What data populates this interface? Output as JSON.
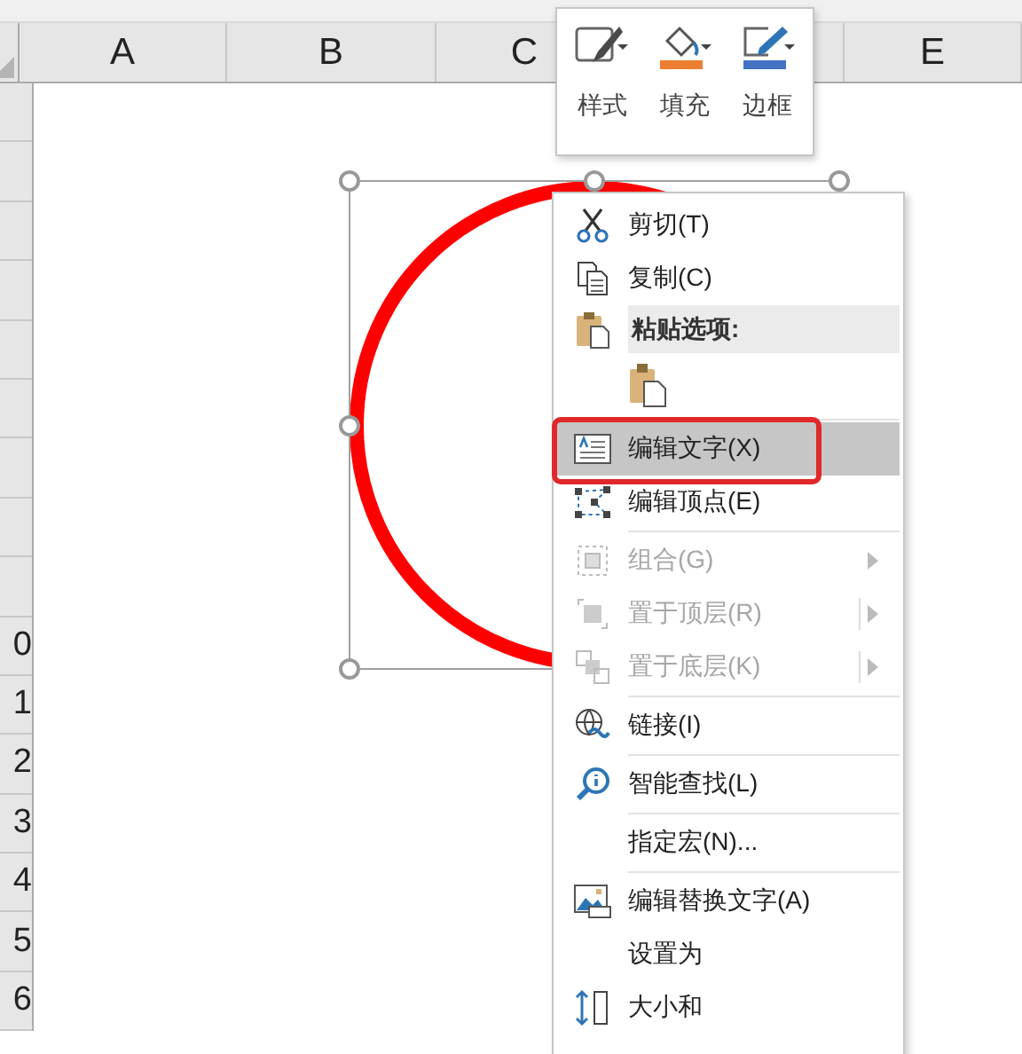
{
  "column_headers": [
    "A",
    "B",
    "C",
    "E"
  ],
  "row_headers": [
    "0",
    "1",
    "2",
    "3",
    "4",
    "5",
    "6"
  ],
  "mini_toolbar": [
    {
      "label": "样式",
      "kind": "style"
    },
    {
      "label": "填充",
      "kind": "fill",
      "color": "#ed7d31"
    },
    {
      "label": "边框",
      "kind": "outline",
      "color": "#4472c4"
    }
  ],
  "context_menu": [
    {
      "kind": "item",
      "label": "剪切(T)",
      "disabled": false,
      "selected": false
    },
    {
      "kind": "item",
      "label": "复制(C)",
      "disabled": false,
      "selected": false
    },
    {
      "kind": "header",
      "label": "粘贴选项:"
    },
    {
      "kind": "paste_options"
    },
    {
      "kind": "separator"
    },
    {
      "kind": "item",
      "label": "编辑文字(X)",
      "disabled": false,
      "selected": true
    },
    {
      "kind": "item",
      "label": "编辑顶点(E)",
      "disabled": false,
      "selected": false
    },
    {
      "kind": "separator"
    },
    {
      "kind": "submenu",
      "label": "组合(G)",
      "disabled": true,
      "selected": false
    },
    {
      "kind": "split_submenu",
      "label": "置于顶层(R)",
      "disabled": true,
      "selected": false
    },
    {
      "kind": "split_submenu",
      "label": "置于底层(K)",
      "disabled": true,
      "selected": false
    },
    {
      "kind": "separator"
    },
    {
      "kind": "item",
      "label": "链接(I)",
      "disabled": false,
      "selected": false
    },
    {
      "kind": "separator"
    },
    {
      "kind": "item",
      "label": "智能查找(L)",
      "disabled": false,
      "selected": false
    },
    {
      "kind": "separator"
    },
    {
      "kind": "item",
      "label": "指定宏(N)...",
      "disabled": false,
      "selected": false
    },
    {
      "kind": "separator"
    },
    {
      "kind": "item",
      "label": "编辑替换文字(A)",
      "disabled": false,
      "selected": false
    },
    {
      "kind": "item",
      "label": "设置为",
      "disabled": false,
      "selected": false
    },
    {
      "kind": "item",
      "label": "大小和",
      "disabled": false,
      "selected": false
    }
  ]
}
